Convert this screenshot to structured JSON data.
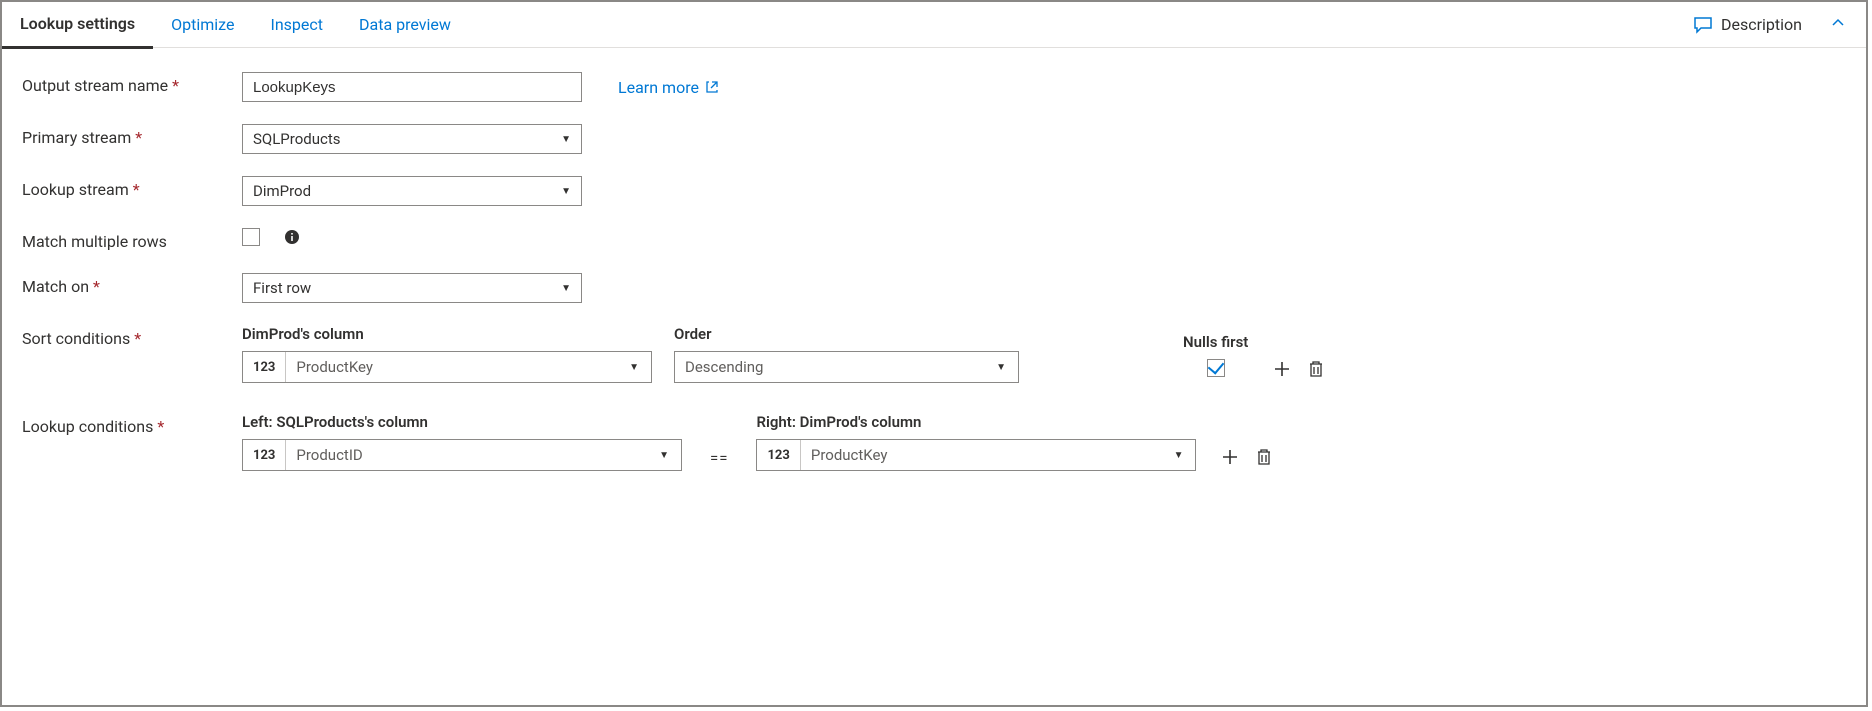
{
  "tabs": {
    "lookup_settings": "Lookup settings",
    "optimize": "Optimize",
    "inspect": "Inspect",
    "data_preview": "Data preview"
  },
  "header": {
    "description": "Description"
  },
  "labels": {
    "output_stream_name": "Output stream name",
    "primary_stream": "Primary stream",
    "lookup_stream": "Lookup stream",
    "match_multiple_rows": "Match multiple rows",
    "match_on": "Match on",
    "sort_conditions": "Sort conditions",
    "lookup_conditions": "Lookup conditions"
  },
  "fields": {
    "output_stream_name": "LookupKeys",
    "primary_stream": "SQLProducts",
    "lookup_stream": "DimProd",
    "match_multiple_rows": false,
    "match_on": "First row",
    "learn_more": "Learn more"
  },
  "sort": {
    "column_header": "DimProd's column",
    "order_header": "Order",
    "nulls_first_header": "Nulls first",
    "type_badge": "123",
    "column": "ProductKey",
    "order": "Descending",
    "nulls_first": true
  },
  "lookup": {
    "left_header": "Left: SQLProducts's column",
    "right_header": "Right: DimProd's column",
    "type_badge": "123",
    "left_column": "ProductID",
    "right_column": "ProductKey",
    "operator": "=="
  }
}
